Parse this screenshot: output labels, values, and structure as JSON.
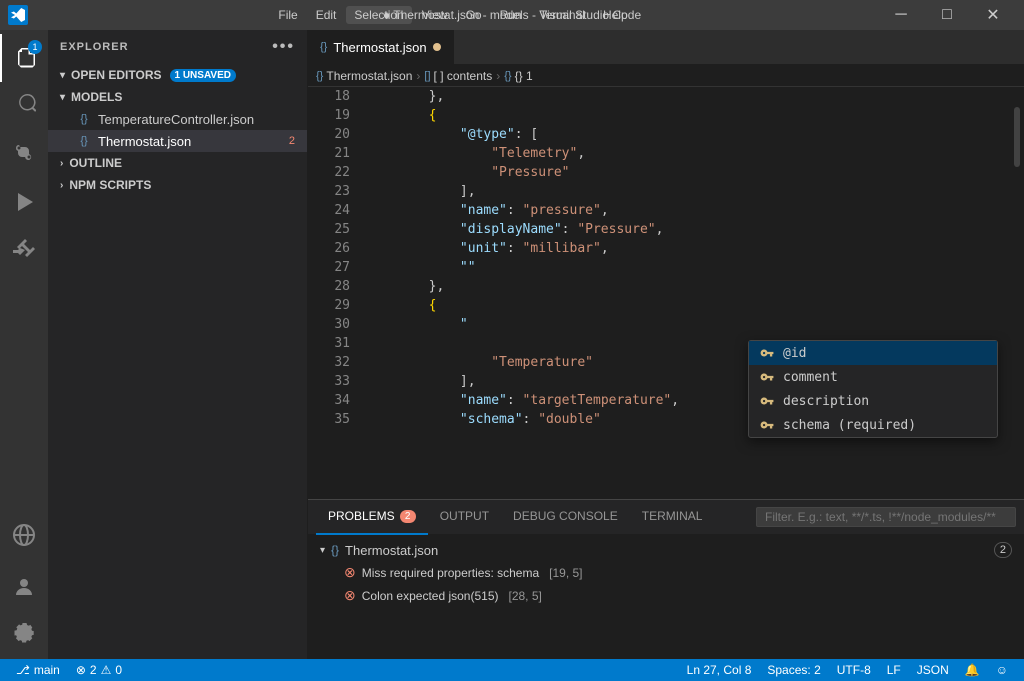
{
  "titlebar": {
    "title": "● Thermostat.json - models - Visual Studio Code",
    "menu": [
      "File",
      "Edit",
      "Selection",
      "View",
      "Go",
      "Run",
      "Terminal",
      "Help"
    ],
    "controls": [
      "─",
      "□",
      "✕"
    ]
  },
  "activity_bar": {
    "items": [
      {
        "name": "explorer",
        "icon": "⎘",
        "badge": "1",
        "active": true
      },
      {
        "name": "search",
        "icon": "🔍"
      },
      {
        "name": "source-control",
        "icon": "⑂"
      },
      {
        "name": "run",
        "icon": "▷"
      },
      {
        "name": "extensions",
        "icon": "⊞"
      }
    ],
    "bottom": [
      {
        "name": "remote",
        "icon": "⊕"
      },
      {
        "name": "account",
        "icon": "👤"
      },
      {
        "name": "settings",
        "icon": "⚙"
      }
    ]
  },
  "sidebar": {
    "header": "EXPLORER",
    "more_icon": "•••",
    "open_editors": {
      "label": "OPEN EDITORS",
      "badge": "1 UNSAVED",
      "collapsed": false
    },
    "models": {
      "label": "MODELS",
      "files": [
        {
          "name": "TemperatureController.json",
          "icon": "{}",
          "active": false,
          "errors": 0
        },
        {
          "name": "Thermostat.json",
          "icon": "{}",
          "active": true,
          "errors": 2
        }
      ]
    },
    "outline": "OUTLINE",
    "npm_scripts": "NPM SCRIPTS"
  },
  "editor": {
    "tab": {
      "label": "Thermostat.json",
      "modified": true,
      "icon": "{}"
    },
    "breadcrumb": [
      {
        "text": "Thermostat.json",
        "icon": "{}"
      },
      {
        "text": "[ ] contents",
        "icon": "[]"
      },
      {
        "text": "{} 1",
        "icon": "{}"
      }
    ],
    "lines": [
      {
        "num": 18,
        "content": [
          {
            "t": "        },",
            "c": "s-punct"
          }
        ]
      },
      {
        "num": 19,
        "content": [
          {
            "t": "        {",
            "c": "s-bracket"
          }
        ]
      },
      {
        "num": 20,
        "content": [
          {
            "t": "            ",
            "c": ""
          },
          {
            "t": "\"@type\"",
            "c": "s-key"
          },
          {
            "t": ": [",
            "c": "s-punct"
          }
        ]
      },
      {
        "num": 21,
        "content": [
          {
            "t": "                ",
            "c": ""
          },
          {
            "t": "\"Telemetry\"",
            "c": "s-value-str"
          },
          {
            "t": ",",
            "c": "s-punct"
          }
        ]
      },
      {
        "num": 22,
        "content": [
          {
            "t": "                ",
            "c": ""
          },
          {
            "t": "\"Pressure\"",
            "c": "s-value-str"
          }
        ]
      },
      {
        "num": 23,
        "content": [
          {
            "t": "            ],",
            "c": "s-punct"
          }
        ]
      },
      {
        "num": 24,
        "content": [
          {
            "t": "            ",
            "c": ""
          },
          {
            "t": "\"name\"",
            "c": "s-key"
          },
          {
            "t": ": ",
            "c": "s-punct"
          },
          {
            "t": "\"pressure\"",
            "c": "s-value-str"
          },
          {
            "t": ",",
            "c": "s-punct"
          }
        ]
      },
      {
        "num": 25,
        "content": [
          {
            "t": "            ",
            "c": ""
          },
          {
            "t": "\"displayName\"",
            "c": "s-key"
          },
          {
            "t": ": ",
            "c": "s-punct"
          },
          {
            "t": "\"Pressure\"",
            "c": "s-value-str"
          },
          {
            "t": ",",
            "c": "s-punct"
          }
        ]
      },
      {
        "num": 26,
        "content": [
          {
            "t": "            ",
            "c": ""
          },
          {
            "t": "\"unit\"",
            "c": "s-key"
          },
          {
            "t": ": ",
            "c": "s-punct"
          },
          {
            "t": "\"millibar\"",
            "c": "s-value-str"
          },
          {
            "t": ",",
            "c": "s-punct"
          }
        ]
      },
      {
        "num": 27,
        "content": [
          {
            "t": "            ",
            "c": ""
          },
          {
            "t": "\"\"",
            "c": "s-key"
          }
        ]
      },
      {
        "num": 28,
        "content": [
          {
            "t": "        },",
            "c": "s-punct"
          }
        ]
      },
      {
        "num": 29,
        "content": [
          {
            "t": "        {",
            "c": "s-bracket"
          }
        ]
      },
      {
        "num": 30,
        "content": [
          {
            "t": "            ",
            "c": ""
          },
          {
            "t": "\"",
            "c": "s-key"
          }
        ]
      },
      {
        "num": 31,
        "content": [
          {
            "t": "                ",
            "c": ""
          }
        ]
      },
      {
        "num": 32,
        "content": [
          {
            "t": "                ",
            "c": ""
          },
          {
            "t": "\"Temperature\"",
            "c": "s-value-str"
          }
        ]
      },
      {
        "num": 33,
        "content": [
          {
            "t": "            ],",
            "c": "s-punct"
          }
        ]
      },
      {
        "num": 34,
        "content": [
          {
            "t": "            ",
            "c": ""
          },
          {
            "t": "\"name\"",
            "c": "s-key"
          },
          {
            "t": ": ",
            "c": "s-punct"
          },
          {
            "t": "\"targetTemperature\"",
            "c": "s-value-str"
          },
          {
            "t": ",",
            "c": "s-punct"
          }
        ]
      },
      {
        "num": 35,
        "content": [
          {
            "t": "            ",
            "c": ""
          },
          {
            "t": "\"schema\"",
            "c": "s-key"
          },
          {
            "t": ": ",
            "c": "s-punct"
          },
          {
            "t": "\"double\"",
            "c": "s-value-str"
          }
        ]
      }
    ],
    "autocomplete": {
      "items": [
        {
          "icon": "🔑",
          "text": "@id",
          "selected": true
        },
        {
          "icon": "🔑",
          "text": "comment"
        },
        {
          "icon": "🔑",
          "text": "description"
        },
        {
          "icon": "🔑",
          "text": "schema (required)"
        }
      ]
    }
  },
  "bottom_panel": {
    "tabs": [
      {
        "label": "PROBLEMS",
        "badge": "2",
        "active": true
      },
      {
        "label": "OUTPUT",
        "active": false
      },
      {
        "label": "DEBUG CONSOLE",
        "active": false
      },
      {
        "label": "TERMINAL",
        "active": false
      }
    ],
    "filter_placeholder": "Filter. E.g.: text, **/*.ts, !**/node_modules/**",
    "problems": {
      "file": "Thermostat.json",
      "count": 2,
      "items": [
        {
          "text": "Miss required properties: schema",
          "location": "[19, 5]"
        },
        {
          "text": "Colon expected json(515)",
          "location": "[28, 5]"
        }
      ]
    }
  },
  "statusbar": {
    "left": [
      {
        "icon": "⟳",
        "text": "2",
        "extra": "⚠ 0"
      },
      {
        "icon": "",
        "text": "main"
      }
    ],
    "right": [
      {
        "text": "Ln 27, Col 8"
      },
      {
        "text": "Spaces: 2"
      },
      {
        "text": "UTF-8"
      },
      {
        "text": "LF"
      },
      {
        "text": "JSON"
      },
      {
        "icon": "🔔",
        "text": ""
      },
      {
        "icon": "👤",
        "text": ""
      }
    ]
  }
}
